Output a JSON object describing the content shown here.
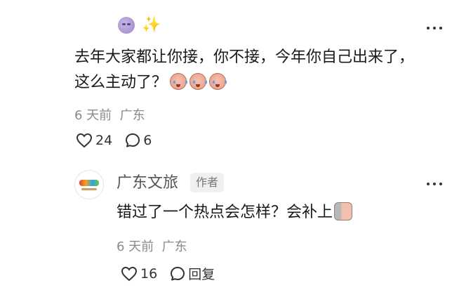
{
  "comment": {
    "badges": [
      "purple-face-emoji",
      "sparkles-emoji"
    ],
    "text": "去年大家都让你接，你不接，今年你自己出来了，这么主动了？",
    "emojis": [
      "crying-face-emoji",
      "crying-face-emoji",
      "crying-face-emoji"
    ],
    "time": "6 天前",
    "location": "广东",
    "likes": "24",
    "replies": "6"
  },
  "reply": {
    "avatar": "广东文旅-logo",
    "name": "广东文旅",
    "badge": "作者",
    "text": "错过了一个热点会怎样？会补上",
    "emoji": "doge-hiding-emoji",
    "time": "6 天前",
    "location": "广东",
    "likes": "16",
    "reply_label": "回复"
  }
}
